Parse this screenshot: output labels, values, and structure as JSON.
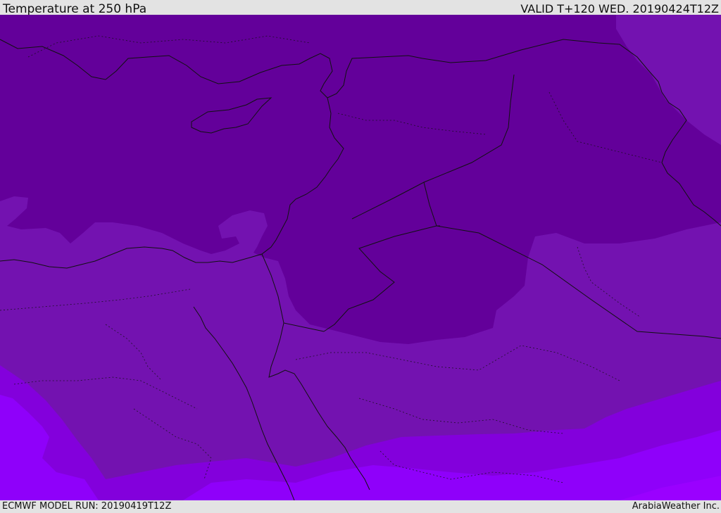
{
  "header": {
    "title": "Temperature at 250 hPa",
    "valid_time": "VALID T+120 WED. 20190424T12Z"
  },
  "footer": {
    "model_run": "ECMWF MODEL RUN: 20190419T12Z",
    "credit": "ArabiaWeather Inc."
  },
  "map": {
    "colors": {
      "coldest": "#63009a",
      "cold": "#7312b0",
      "mid": "#8300dc",
      "warm": "#8f00fa",
      "warmest": "#9a00ff",
      "boundary": "#111111"
    }
  }
}
